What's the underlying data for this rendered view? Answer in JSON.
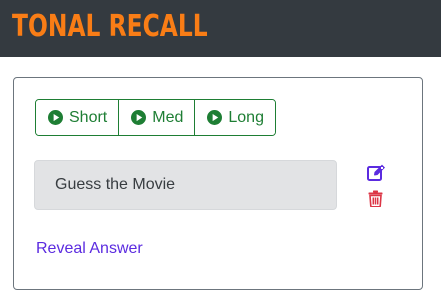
{
  "app": {
    "brand": "TONAL RECALL"
  },
  "clip_buttons": [
    {
      "label": "Short",
      "icon": "play-circle-icon"
    },
    {
      "label": "Med",
      "icon": "play-circle-icon"
    },
    {
      "label": "Long",
      "icon": "play-circle-icon"
    }
  ],
  "card": {
    "title": "Guess the Movie",
    "edit_icon": "edit-icon",
    "delete_icon": "trash-icon",
    "reveal_label": "Reveal Answer"
  },
  "colors": {
    "navbar": "#343a40",
    "brand": "#f97d16",
    "success": "#1e7e34",
    "edit": "#5b2be0",
    "delete": "#dc3545",
    "link": "#5b2be0"
  }
}
